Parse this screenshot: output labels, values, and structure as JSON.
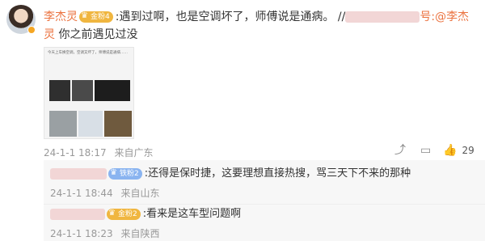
{
  "main_comment": {
    "username": "李杰灵",
    "badge": "金粉4",
    "text": ":遇到过啊，也是空调坏了，师傅说是通病。",
    "forward_sep": "//",
    "forward_suffix": "号:",
    "mention": "@李杰灵",
    "tail": "你之前遇见过没",
    "timestamp": "24-1-1 18:17",
    "location": "来自广东",
    "like_count": "29",
    "thumb_caption": "今天上车换空调，空调又坏了，师傅说是通病……"
  },
  "replies": [
    {
      "badge": "铁粉2",
      "text": ":还得是保时捷，这要理想直接热搜，骂三天下不来的那种",
      "timestamp": "24-1-1 18:44",
      "location": "来自山东"
    },
    {
      "badge": "金粉2",
      "text": ":看来是这车型问题啊",
      "timestamp": "24-1-1 18:23",
      "location": "来自陕西"
    }
  ],
  "icons": {
    "share": "share-icon",
    "reply": "comment-icon",
    "like": "thumbs-up-icon"
  },
  "colors": {
    "username": "#eb7340",
    "meta": "#999999"
  }
}
